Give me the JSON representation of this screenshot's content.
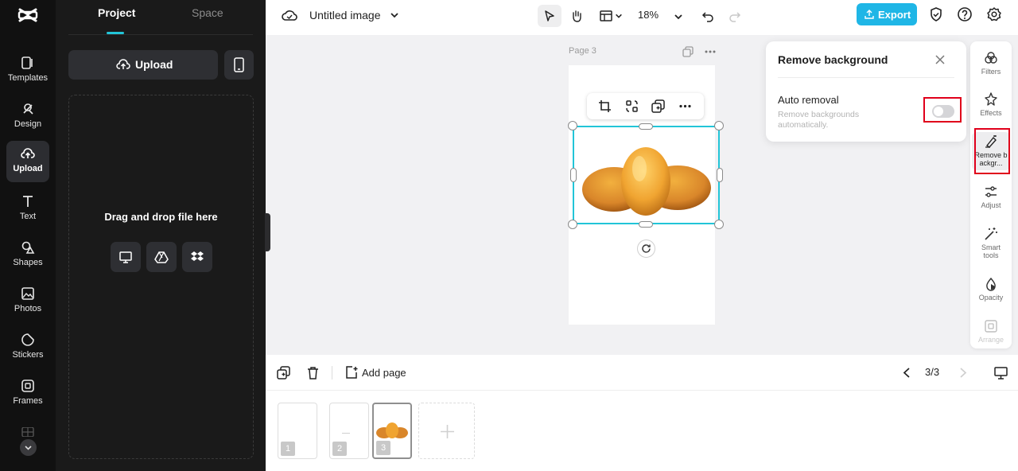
{
  "sidebar": {
    "items": [
      {
        "label": "Templates",
        "icon": "templates-icon"
      },
      {
        "label": "Design",
        "icon": "design-icon"
      },
      {
        "label": "Upload",
        "icon": "upload-icon",
        "active": true
      },
      {
        "label": "Text",
        "icon": "text-icon"
      },
      {
        "label": "Shapes",
        "icon": "shapes-icon"
      },
      {
        "label": "Photos",
        "icon": "photos-icon"
      },
      {
        "label": "Stickers",
        "icon": "stickers-icon"
      },
      {
        "label": "Frames",
        "icon": "frames-icon"
      }
    ]
  },
  "panel": {
    "tabs": [
      "Project",
      "Space"
    ],
    "upload_label": "Upload",
    "dropzone_text": "Drag and drop file here"
  },
  "topbar": {
    "title": "Untitled image",
    "zoom": "18%",
    "export_label": "Export"
  },
  "canvas": {
    "page_label": "Page 3"
  },
  "remove_bg": {
    "title": "Remove background",
    "toggle_label": "Auto removal",
    "toggle_desc": "Remove backgrounds automatically.",
    "toggle_on": false
  },
  "right_panel": {
    "items": [
      {
        "label": "Filters"
      },
      {
        "label": "Effects"
      },
      {
        "label": "Remove backgr..."
      },
      {
        "label": "Adjust"
      },
      {
        "label": "Smart tools"
      },
      {
        "label": "Opacity"
      },
      {
        "label": "Arrange"
      }
    ]
  },
  "bottom": {
    "add_page_label": "Add page",
    "pager": "3/3",
    "thumbs": [
      "1",
      "2",
      "3"
    ]
  },
  "colors": {
    "accent": "#22c5d8",
    "export": "#1fb6e6",
    "highlight": "#e0001b"
  }
}
